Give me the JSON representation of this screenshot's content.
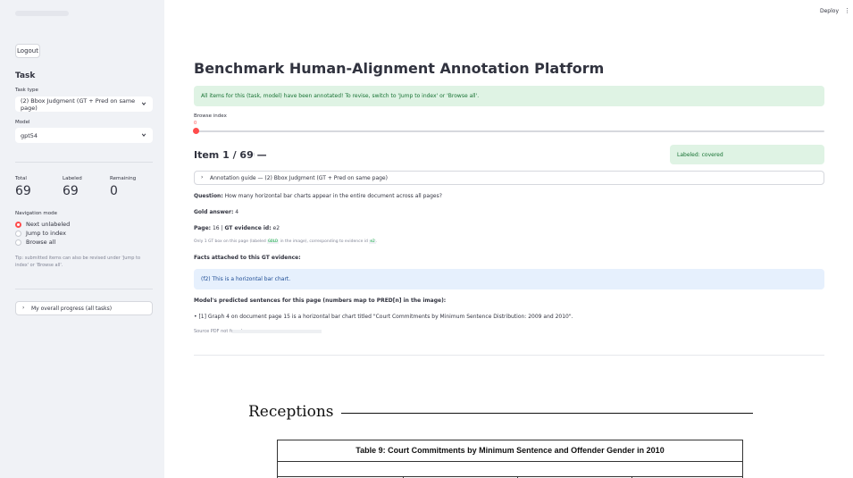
{
  "sidebar": {
    "logout_label": "Logout",
    "task_section_title": "Task",
    "task_type_label": "Task type",
    "task_type_value": "(2) Bbox Judgment (GT + Pred on same page)",
    "model_label": "Model",
    "model_value": "gpt54",
    "stats": [
      {
        "label": "Total",
        "value": "69"
      },
      {
        "label": "Labeled",
        "value": "69"
      },
      {
        "label": "Remaining",
        "value": "0"
      }
    ],
    "nav_mode_label": "Navigation mode",
    "nav_options": [
      {
        "label": "Next unlabeled",
        "selected": true
      },
      {
        "label": "Jump to index",
        "selected": false
      },
      {
        "label": "Browse all",
        "selected": false
      }
    ],
    "tip": "Tip: submitted items can also be revised under 'Jump to index' or 'Browse all'.",
    "progress_expander": "My overall progress (all tasks)"
  },
  "header": {
    "deploy_label": "Deploy",
    "menu_glyph": "⋮"
  },
  "main": {
    "title": "Benchmark Human-Alignment Annotation Platform",
    "success_message": "All items for this (task, model) have been annotated! To revise, switch to 'Jump to index' or 'Browse all'.",
    "browse_index_label": "Browse index",
    "browse_index_value": "0",
    "item_heading": "Item 1 / 69 —",
    "labeled_status": "Labeled: covered",
    "guide_expander": "Annotation guide — (2) Bbox Judgment (GT + Pred on same page)",
    "question_label": "Question:",
    "question_text": "How many horizontal bar charts appear in the entire document across all pages?",
    "gold_label": "Gold answer:",
    "gold_value": "4",
    "page_label": "Page:",
    "page_value": "16",
    "gt_evidence_label": "GT evidence id:",
    "gt_evidence_value": "e2",
    "gt_box_note_pre": "Only 1 GT box on this page (labeled",
    "gt_box_code": "GOLD",
    "gt_box_note_mid": "in the image), corresponding to evidence id",
    "gt_box_code2": "e2",
    "gt_box_note_end": ".",
    "facts_heading": "Facts attached to this GT evidence:",
    "fact_info": "(f2) This is a horizontal bar chart.",
    "pred_heading": "Model's predicted sentences for this page (numbers map to PRED[n] in the image):",
    "pred_bullet": "[1] Graph 4 on document page 15 is a horizontal bar chart titled \"Court Commitments by Minimum Sentence Distribution: 2009 and 2010\".",
    "source_note": "Source PDF not found:"
  },
  "pdf": {
    "heading": "Receptions",
    "table_caption": "Table 9:  Court Commitments by Minimum Sentence and Offender Gender in 2010"
  },
  "colors": {
    "accent": "#ff4b4b",
    "success_bg": "#dff3e4",
    "success_text": "#177233",
    "info_bg": "#e6f0fd",
    "info_text": "#1c4b94",
    "sidebar_bg": "#f0f2f6"
  }
}
